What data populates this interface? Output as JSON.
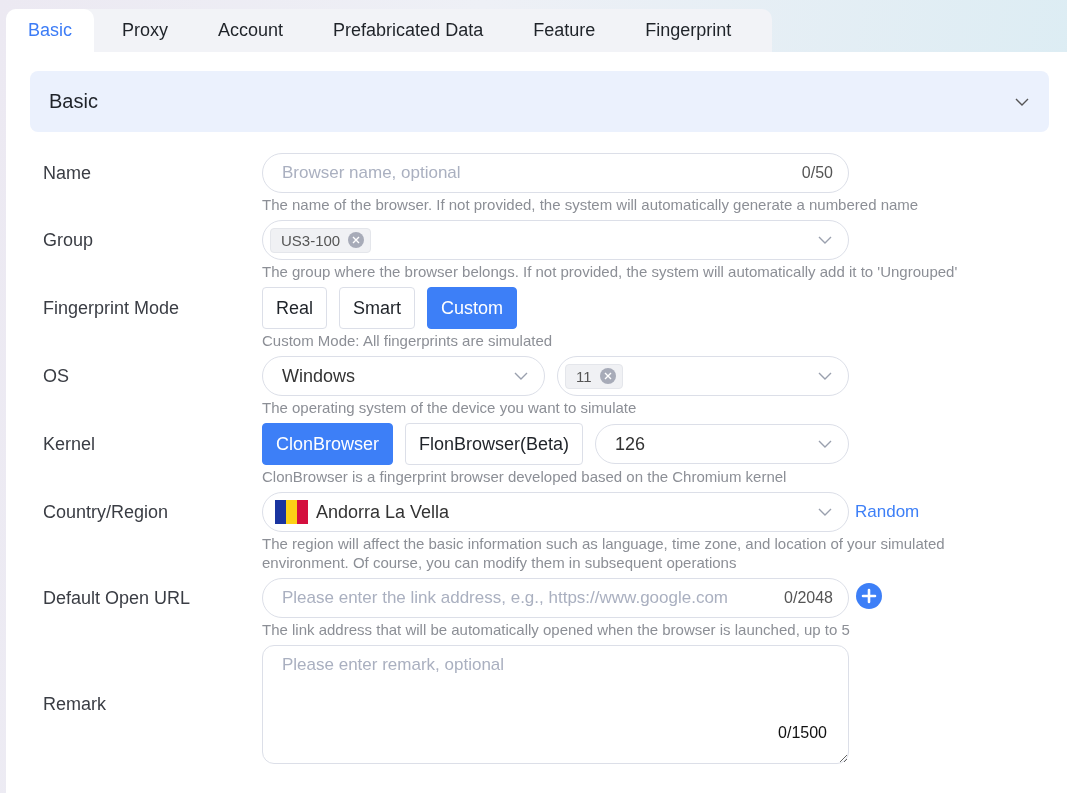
{
  "tabs": [
    {
      "label": "Basic",
      "selected": true
    },
    {
      "label": "Proxy",
      "selected": false
    },
    {
      "label": "Account",
      "selected": false
    },
    {
      "label": "Prefabricated Data",
      "selected": false
    },
    {
      "label": "Feature",
      "selected": false
    },
    {
      "label": "Fingerprint",
      "selected": false
    }
  ],
  "section": {
    "title": "Basic",
    "expanded": true
  },
  "fields": [
    {
      "kind": "text",
      "label": "Name",
      "placeholder": "Browser name, optional",
      "counter": "0/50",
      "hint": "The name of the browser. If not provided, the system will automatically generate a numbered name"
    },
    {
      "kind": "tags",
      "label": "Group",
      "tags": [
        "US3-100"
      ],
      "hint": "The group where the browser belongs. If not provided, the system will automatically add it to 'Ungrouped'"
    },
    {
      "kind": "segmented",
      "label": "Fingerprint Mode",
      "options": [
        {
          "label": "Real",
          "selected": false
        },
        {
          "label": "Smart",
          "selected": false
        },
        {
          "label": "Custom",
          "selected": true
        }
      ],
      "hint": "Custom Mode: All fingerprints are simulated"
    },
    {
      "kind": "os",
      "label": "OS",
      "value": "Windows",
      "tags": [
        "11"
      ],
      "hint": "The operating system of the device you want to simulate"
    },
    {
      "kind": "kernel",
      "label": "Kernel",
      "options": [
        {
          "label": "ClonBrowser",
          "selected": true
        },
        {
          "label": "FlonBrowser(Beta)",
          "selected": false
        }
      ],
      "version": "126",
      "hint": "ClonBrowser is a fingerprint browser developed based on the Chromium kernel"
    },
    {
      "kind": "country",
      "label": "Country/Region",
      "value": "Andorra La Vella",
      "link": "Random",
      "hint": "The region will affect the basic information such as language, time zone, and location of your simulated environment. Of course, you can modify them in subsequent operations"
    },
    {
      "kind": "url",
      "label": "Default Open URL",
      "placeholder": "Please enter the link address, e.g., https://www.google.com",
      "counter": "0/2048",
      "hint": "The link address that will be automatically opened when the browser is launched, up to 5"
    },
    {
      "kind": "textarea",
      "label": "Remark",
      "placeholder": "Please enter remark, optional",
      "counter": "0/1500"
    }
  ]
}
